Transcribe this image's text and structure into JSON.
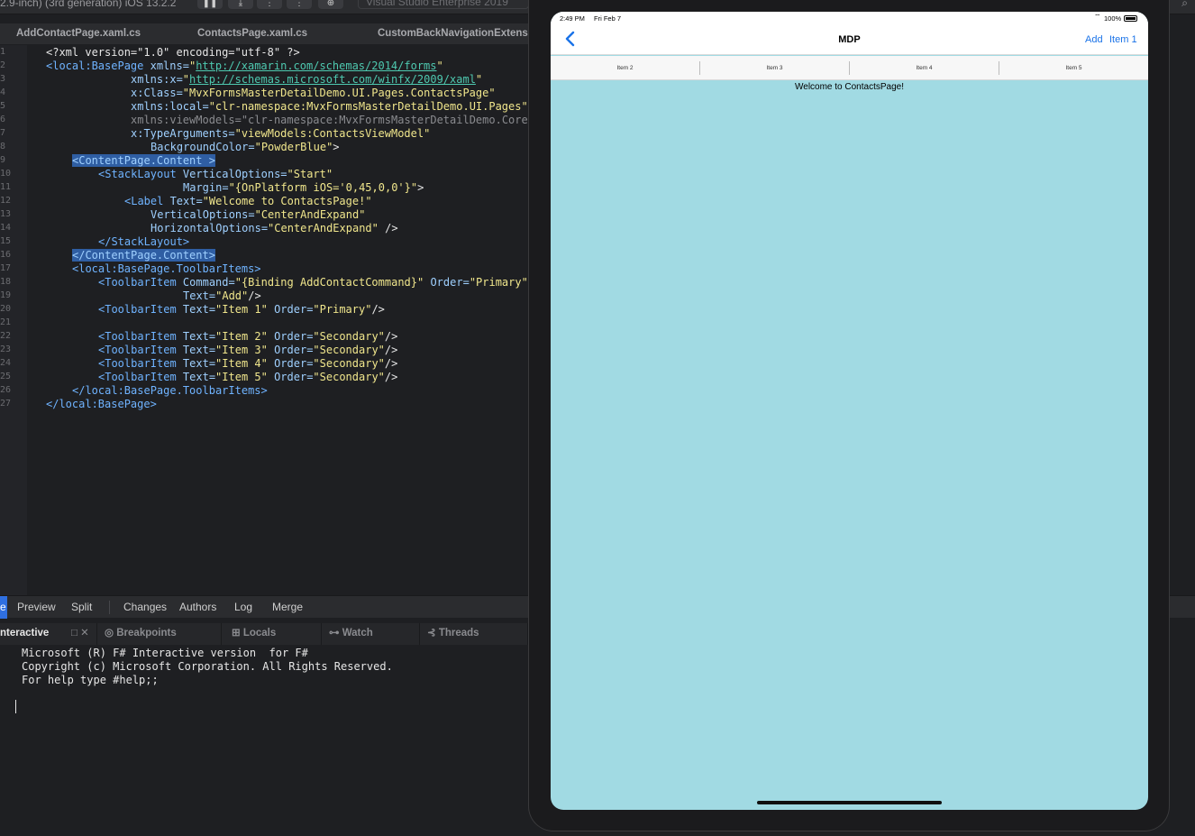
{
  "ide": {
    "device_label": "2.9-inch) (3rd generation) iOS 13.2.2",
    "toolbar_icons": [
      "pause-icon",
      "step-over-icon",
      "step-into-icon",
      "step-out-icon",
      "plus-circle-icon"
    ],
    "toolbar_glyphs": [
      "❚❚",
      "⤓",
      "⋮",
      "⋮",
      "⊕"
    ],
    "search_placeholder": "Visual Studio Enterprise 2019",
    "search_glyph": "⌕",
    "doc_tabs": [
      "AddContactPage.xaml.cs",
      "ContactsPage.xaml.cs",
      "CustomBackNavigationExtens"
    ],
    "line_numbers": [
      "1",
      "2",
      "3",
      "4",
      "5",
      "6",
      "7",
      "8",
      "9",
      "10",
      "11",
      "12",
      "13",
      "14",
      "15",
      "16",
      "17",
      "18",
      "19",
      "20",
      "21",
      "22",
      "23",
      "24",
      "25",
      "26",
      "27"
    ],
    "code": {
      "l1": "<?xml version=\"1.0\" encoding=\"utf-8\" ?>",
      "l2a": "<local:BasePage ",
      "l2b": "xmlns=",
      "l2c": "\"",
      "l2d": "http://xamarin.com/schemas/2014/forms",
      "l2e": "\"",
      "l3a": "xmlns:x=",
      "l3b": "\"",
      "l3c": "http://schemas.microsoft.com/winfx/2009/xaml",
      "l3d": "\"",
      "l4a": "x:Class=",
      "l4b": "\"MvxFormsMasterDetailDemo.UI.Pages.ContactsPage\"",
      "l5a": "xmlns:local=",
      "l5b": "\"clr-namespace:MvxFormsMasterDetailDemo.UI.Pages\"",
      "l6a": "xmlns:viewModels=",
      "l6b": "\"clr-namespace:MvxFormsMasterDetailDemo.Core",
      "l7a": "x:TypeArguments=",
      "l7b": "\"viewModels:ContactsViewModel\"",
      "l8a": "BackgroundColor=",
      "l8b": "\"PowderBlue\"",
      "l8c": ">",
      "l9a": "<ContentPage.Content",
      "l9b": " >",
      "l10a": "<StackLayout ",
      "l10b": "VerticalOptions=",
      "l10c": "\"Start\"",
      "l11a": "Margin=",
      "l11b": "\"{OnPlatform iOS='0,45,0,0'}\"",
      "l11c": ">",
      "l12a": "<Label ",
      "l12b": "Text=",
      "l12c": "\"Welcome to ContactsPage!\"",
      "l13a": "VerticalOptions=",
      "l13b": "\"CenterAndExpand\"",
      "l14a": "HorizontalOptions=",
      "l14b": "\"CenterAndExpand\"",
      "l14c": " />",
      "l15": "</StackLayout>",
      "l16": "</ContentPage.Content>",
      "l17": "<local:BasePage.ToolbarItems>",
      "l18a": "<ToolbarItem ",
      "l18b": "Command=",
      "l18c": "\"{Binding AddContactCommand}\"",
      "l18d": " Order=",
      "l18e": "\"Primary\"",
      "l19a": "Text=",
      "l19b": "\"Add\"",
      "l19c": "/>",
      "l20a": "<ToolbarItem ",
      "l20b": "Text=",
      "l20c": "\"Item 1\"",
      "l20d": " Order=",
      "l20e": "\"Primary\"",
      "l20f": "/>",
      "l22a": "<ToolbarItem ",
      "l22b": "Text=",
      "l22c": "\"Item 2\"",
      "l22d": " Order=",
      "l22e": "\"Secondary\"",
      "l22f": "/>",
      "l23a": "<ToolbarItem ",
      "l23b": "Text=",
      "l23c": "\"Item 3\"",
      "l23d": " Order=",
      "l23e": "\"Secondary\"",
      "l23f": "/>",
      "l24a": "<ToolbarItem ",
      "l24b": "Text=",
      "l24c": "\"Item 4\"",
      "l24d": " Order=",
      "l24e": "\"Secondary\"",
      "l24f": "/>",
      "l25a": "<ToolbarItem ",
      "l25b": "Text=",
      "l25c": "\"Item 5\"",
      "l25d": " Order=",
      "l25e": "\"Secondary\"",
      "l25f": "/>",
      "l26": "</local:BasePage.ToolbarItems>",
      "l27": "</local:BasePage>"
    },
    "view_tabs": [
      "e",
      "Preview",
      "Split",
      "Changes",
      "Authors",
      "Log",
      "Merge"
    ],
    "pad_tabs": {
      "interactive": "nteractive",
      "pad_glyphs": "□ ✕",
      "breakpoints_glyph": "◎",
      "breakpoints": "Breakpoints",
      "locals_glyph": "⊞",
      "locals": "Locals",
      "watch_glyph": "⊶",
      "watch": "Watch",
      "threads_glyph": "⊰",
      "threads": "Threads"
    },
    "console_lines": [
      "Microsoft (R) F# Interactive version  for F#",
      "Copyright (c) Microsoft Corporation. All Rights Reserved.",
      "For help type #help;;"
    ]
  },
  "simulator": {
    "status": {
      "time": "2:49 PM",
      "date": "Fri Feb 7",
      "wifi": "⌔",
      "battery": "100%"
    },
    "nav": {
      "title": "MDP",
      "add": "Add",
      "item1": "Item 1"
    },
    "secondary_items": [
      "Item 2",
      "Item 3",
      "Item 4",
      "Item 5"
    ],
    "welcome": "Welcome to ContactsPage!",
    "colors": {
      "page_background": "#a1dae3",
      "accent": "#1a73e8"
    }
  }
}
